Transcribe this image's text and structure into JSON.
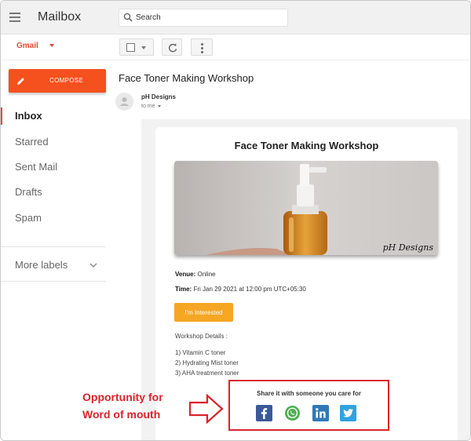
{
  "app": {
    "title": "Mailbox"
  },
  "search": {
    "placeholder": "Search"
  },
  "account": {
    "selected": "Gmail"
  },
  "compose": {
    "label": "COMPOSE"
  },
  "sidebar": {
    "items": [
      {
        "label": "Inbox",
        "active": true
      },
      {
        "label": "Starred"
      },
      {
        "label": "Sent Mail"
      },
      {
        "label": "Drafts"
      },
      {
        "label": "Spam"
      }
    ],
    "more_labels": "More labels"
  },
  "message": {
    "subject": "Face Toner Making Workshop",
    "sender": "pH Designs",
    "recipient": "to me"
  },
  "email": {
    "title": "Face Toner Making Workshop",
    "image_brand": "pH Designs",
    "venue_label": "Venue:",
    "venue": "Online",
    "time_label": "Time:",
    "time": "Fri Jan 29 2021 at 12:00 pm UTC+05:30",
    "cta": "I'm Interested",
    "details_heading": "Workshop Details :",
    "details": [
      "1) Vitamin C toner",
      "2) Hydrating Mist toner",
      "3) AHA treatment toner"
    ],
    "share_text": "Share it with someone you care for",
    "social": [
      "facebook-icon",
      "whatsapp-icon",
      "linkedin-icon",
      "twitter-icon"
    ]
  },
  "annotation": {
    "line1": "Opportunity for",
    "line2": "Word of mouth",
    "color": "#d9242b"
  },
  "colors": {
    "accent": "#dd4b39",
    "compose": "#f4511e",
    "cta": "#f5a623"
  }
}
